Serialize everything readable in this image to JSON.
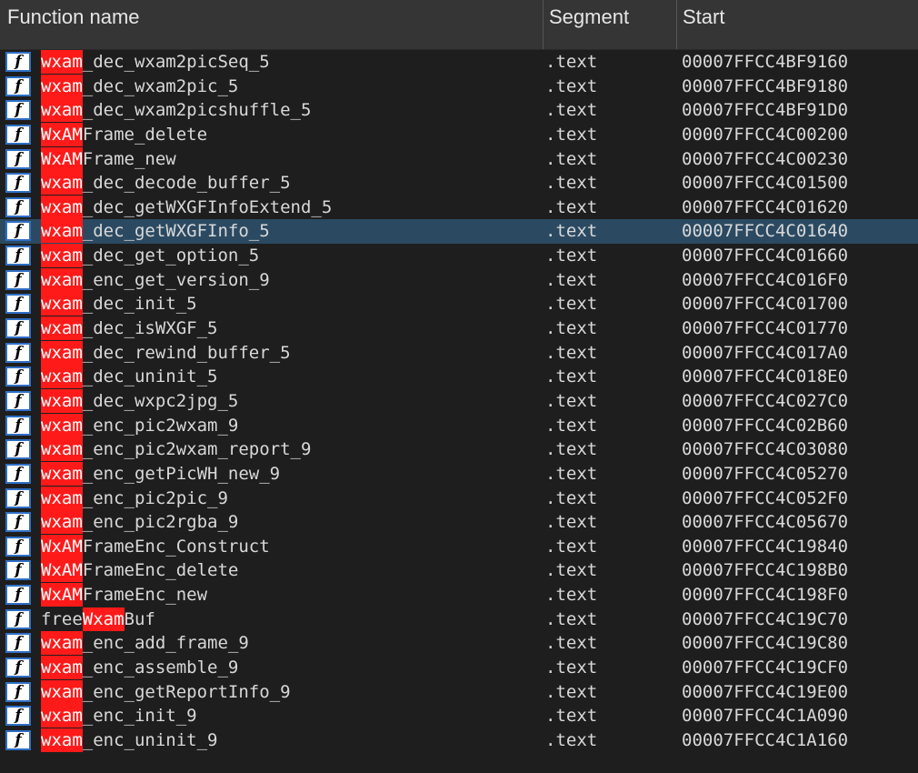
{
  "columns": {
    "name": "Function name",
    "segment": "Segment",
    "start": "Start"
  },
  "icon_glyph": "f",
  "highlight_color": "#ff1a1a",
  "selected_row_color": "#2b4a62",
  "rows": [
    {
      "pre": "",
      "hl": "wxam",
      "post": "_dec_wxam2picSeq_5",
      "segment": ".text",
      "start": "00007FFCC4BF9160",
      "selected": false
    },
    {
      "pre": "",
      "hl": "wxam",
      "post": "_dec_wxam2pic_5",
      "segment": ".text",
      "start": "00007FFCC4BF9180",
      "selected": false
    },
    {
      "pre": "",
      "hl": "wxam",
      "post": "_dec_wxam2picshuffle_5",
      "segment": ".text",
      "start": "00007FFCC4BF91D0",
      "selected": false
    },
    {
      "pre": "",
      "hl": "WxAM",
      "post": "Frame_delete",
      "segment": ".text",
      "start": "00007FFCC4C00200",
      "selected": false
    },
    {
      "pre": "",
      "hl": "WxAM",
      "post": "Frame_new",
      "segment": ".text",
      "start": "00007FFCC4C00230",
      "selected": false
    },
    {
      "pre": "",
      "hl": "wxam",
      "post": "_dec_decode_buffer_5",
      "segment": ".text",
      "start": "00007FFCC4C01500",
      "selected": false
    },
    {
      "pre": "",
      "hl": "wxam",
      "post": "_dec_getWXGFInfoExtend_5",
      "segment": ".text",
      "start": "00007FFCC4C01620",
      "selected": false
    },
    {
      "pre": "",
      "hl": "wxam",
      "post": "_dec_getWXGFInfo_5",
      "segment": ".text",
      "start": "00007FFCC4C01640",
      "selected": true
    },
    {
      "pre": "",
      "hl": "wxam",
      "post": "_dec_get_option_5",
      "segment": ".text",
      "start": "00007FFCC4C01660",
      "selected": false
    },
    {
      "pre": "",
      "hl": "wxam",
      "post": "_enc_get_version_9",
      "segment": ".text",
      "start": "00007FFCC4C016F0",
      "selected": false
    },
    {
      "pre": "",
      "hl": "wxam",
      "post": "_dec_init_5",
      "segment": ".text",
      "start": "00007FFCC4C01700",
      "selected": false
    },
    {
      "pre": "",
      "hl": "wxam",
      "post": "_dec_isWXGF_5",
      "segment": ".text",
      "start": "00007FFCC4C01770",
      "selected": false
    },
    {
      "pre": "",
      "hl": "wxam",
      "post": "_dec_rewind_buffer_5",
      "segment": ".text",
      "start": "00007FFCC4C017A0",
      "selected": false
    },
    {
      "pre": "",
      "hl": "wxam",
      "post": "_dec_uninit_5",
      "segment": ".text",
      "start": "00007FFCC4C018E0",
      "selected": false
    },
    {
      "pre": "",
      "hl": "wxam",
      "post": "_dec_wxpc2jpg_5",
      "segment": ".text",
      "start": "00007FFCC4C027C0",
      "selected": false
    },
    {
      "pre": "",
      "hl": "wxam",
      "post": "_enc_pic2wxam_9",
      "segment": ".text",
      "start": "00007FFCC4C02B60",
      "selected": false
    },
    {
      "pre": "",
      "hl": "wxam",
      "post": "_enc_pic2wxam_report_9",
      "segment": ".text",
      "start": "00007FFCC4C03080",
      "selected": false
    },
    {
      "pre": "",
      "hl": "wxam",
      "post": "_enc_getPicWH_new_9",
      "segment": ".text",
      "start": "00007FFCC4C05270",
      "selected": false
    },
    {
      "pre": "",
      "hl": "wxam",
      "post": "_enc_pic2pic_9",
      "segment": ".text",
      "start": "00007FFCC4C052F0",
      "selected": false
    },
    {
      "pre": "",
      "hl": "wxam",
      "post": "_enc_pic2rgba_9",
      "segment": ".text",
      "start": "00007FFCC4C05670",
      "selected": false
    },
    {
      "pre": "",
      "hl": "WxAM",
      "post": "FrameEnc_Construct",
      "segment": ".text",
      "start": "00007FFCC4C19840",
      "selected": false
    },
    {
      "pre": "",
      "hl": "WxAM",
      "post": "FrameEnc_delete",
      "segment": ".text",
      "start": "00007FFCC4C198B0",
      "selected": false
    },
    {
      "pre": "",
      "hl": "WxAM",
      "post": "FrameEnc_new",
      "segment": ".text",
      "start": "00007FFCC4C198F0",
      "selected": false
    },
    {
      "pre": "free",
      "hl": "Wxam",
      "post": "Buf",
      "segment": ".text",
      "start": "00007FFCC4C19C70",
      "selected": false
    },
    {
      "pre": "",
      "hl": "wxam",
      "post": "_enc_add_frame_9",
      "segment": ".text",
      "start": "00007FFCC4C19C80",
      "selected": false
    },
    {
      "pre": "",
      "hl": "wxam",
      "post": "_enc_assemble_9",
      "segment": ".text",
      "start": "00007FFCC4C19CF0",
      "selected": false
    },
    {
      "pre": "",
      "hl": "wxam",
      "post": "_enc_getReportInfo_9",
      "segment": ".text",
      "start": "00007FFCC4C19E00",
      "selected": false
    },
    {
      "pre": "",
      "hl": "wxam",
      "post": "_enc_init_9",
      "segment": ".text",
      "start": "00007FFCC4C1A090",
      "selected": false
    },
    {
      "pre": "",
      "hl": "wxam",
      "post": "_enc_uninit_9",
      "segment": ".text",
      "start": "00007FFCC4C1A160",
      "selected": false
    }
  ]
}
